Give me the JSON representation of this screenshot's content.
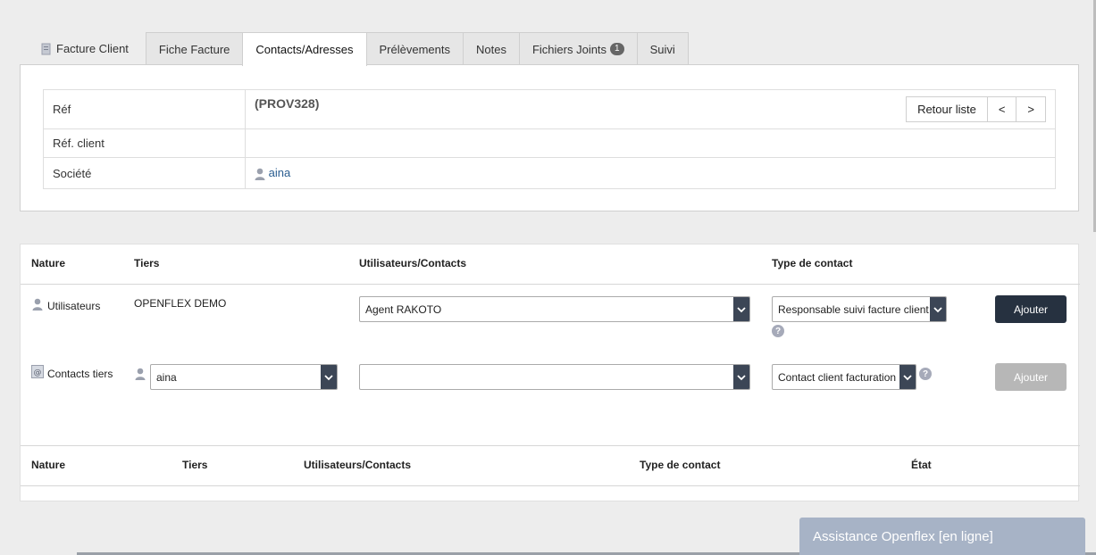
{
  "tabs": {
    "main_label": "Facture Client",
    "items": [
      {
        "label": "Fiche Facture"
      },
      {
        "label": "Contacts/Adresses"
      },
      {
        "label": "Prélèvements"
      },
      {
        "label": "Notes"
      },
      {
        "label": "Fichiers Joints"
      },
      {
        "label": "Suivi"
      }
    ],
    "fichiers_count": "1"
  },
  "info": {
    "ref_label": "Réf",
    "ref_value": "(PROV328)",
    "ref_client_label": "Réf. client",
    "ref_client_value": "",
    "societe_label": "Société",
    "societe_value": "aina",
    "back_list_label": "Retour liste",
    "prev_label": "<",
    "next_label": ">"
  },
  "add_table": {
    "headers": {
      "nature": "Nature",
      "tiers": "Tiers",
      "users": "Utilisateurs/Contacts",
      "type": "Type de contact"
    },
    "row_users": {
      "nature": "Utilisateurs",
      "tiers": "OPENFLEX DEMO",
      "user_select": "Agent RAKOTO",
      "type_select": "Responsable suivi facture client",
      "add_label": "Ajouter"
    },
    "row_contacts": {
      "nature": "Contacts tiers",
      "tiers_select": "aina",
      "contact_select": "",
      "type_select": "Contact client facturation",
      "add_label": "Ajouter"
    }
  },
  "list_table": {
    "headers": {
      "nature": "Nature",
      "tiers": "Tiers",
      "users": "Utilisateurs/Contacts",
      "type": "Type de contact",
      "etat": "État"
    }
  },
  "assistance": {
    "label": "Assistance Openflex [en ligne]"
  },
  "help_glyph": "?"
}
